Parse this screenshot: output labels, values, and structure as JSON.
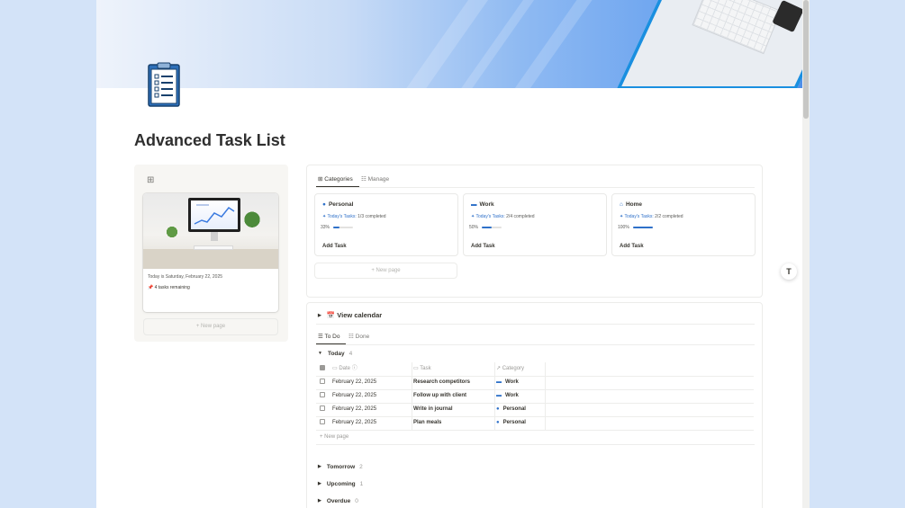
{
  "page": {
    "title": "Advanced Task List",
    "icon": "clipboard-checklist-icon"
  },
  "gallery": {
    "icon": "gallery-grid-icon",
    "card": {
      "date_text": "Today is Saturday, February 22, 2025",
      "remaining_text": "4 tasks remaining"
    },
    "new_page_label": "+ New page"
  },
  "categories_view": {
    "tabs": [
      {
        "label": "Categories",
        "icon": "gallery-grid-icon",
        "active": true
      },
      {
        "label": "Manage",
        "icon": "list-settings-icon",
        "active": false
      }
    ],
    "cards": [
      {
        "name": "Personal",
        "icon": "person-circle-icon",
        "tasks_label": "Today's Tasks:",
        "tasks_value": "1/3 completed",
        "percent_label": "33%",
        "progress": 0.33,
        "add_label": "Add Task"
      },
      {
        "name": "Work",
        "icon": "briefcase-icon",
        "tasks_label": "Today's Tasks:",
        "tasks_value": "2/4 completed",
        "percent_label": "50%",
        "progress": 0.5,
        "add_label": "Add Task"
      },
      {
        "name": "Home",
        "icon": "house-icon",
        "tasks_label": "Today's Tasks:",
        "tasks_value": "2/2 completed",
        "percent_label": "100%",
        "progress": 1.0,
        "add_label": "Add Task"
      }
    ],
    "new_page_label": "+ New page"
  },
  "task_list": {
    "calendar_toggle": "View calendar",
    "calendar_emoji": "📅",
    "view_tabs": [
      {
        "label": "To Do",
        "active": true
      },
      {
        "label": "Done",
        "active": false
      }
    ],
    "groups": [
      {
        "name": "Today",
        "count": "4"
      },
      {
        "name": "Tomorrow",
        "count": "2"
      },
      {
        "name": "Upcoming",
        "count": "1"
      },
      {
        "name": "Overdue",
        "count": "0"
      }
    ],
    "columns": {
      "date": "Date",
      "task": "Task",
      "category": "Category"
    },
    "rows": [
      {
        "date": "February 22, 2025",
        "task": "Research competitors",
        "category": "Work"
      },
      {
        "date": "February 22, 2025",
        "task": "Follow up with client",
        "category": "Work"
      },
      {
        "date": "February 22, 2025",
        "task": "Write in journal",
        "category": "Personal"
      },
      {
        "date": "February 22, 2025",
        "task": "Plan meals",
        "category": "Personal"
      }
    ],
    "new_row_label": "+ New page"
  },
  "colors": {
    "accent": "#2f71c9",
    "outer_background": "#d3e3f8"
  }
}
